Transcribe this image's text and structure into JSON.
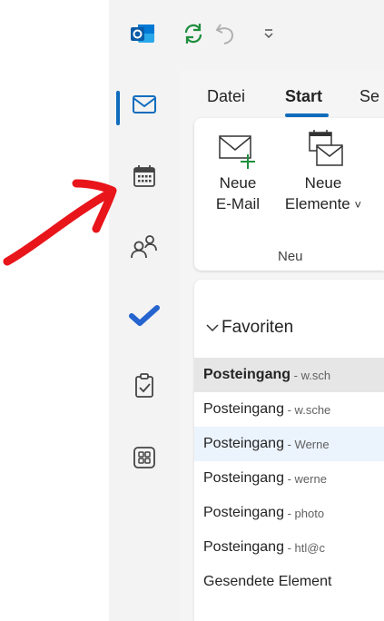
{
  "titlebar": {
    "icons": [
      "outlook-logo-icon",
      "sync-icon",
      "undo-icon",
      "customize-quick-access-icon"
    ]
  },
  "rail": {
    "items": [
      {
        "name": "mail",
        "icon": "mail-icon",
        "active": true
      },
      {
        "name": "calendar",
        "icon": "calendar-icon",
        "active": false
      },
      {
        "name": "people",
        "icon": "people-icon",
        "active": false
      },
      {
        "name": "todo",
        "icon": "todo-check-icon",
        "active": false
      },
      {
        "name": "tasks",
        "icon": "clipboard-icon",
        "active": false
      },
      {
        "name": "apps",
        "icon": "apps-icon",
        "active": false
      }
    ]
  },
  "tabs": [
    {
      "label": "Datei",
      "active": false
    },
    {
      "label": "Start",
      "active": true
    },
    {
      "label": "Se",
      "active": false
    }
  ],
  "ribbon": {
    "new_mail": {
      "line1": "Neue",
      "line2": "E-Mail"
    },
    "new_items": {
      "line1": "Neue",
      "line2": "Elemente",
      "chevron": "˅"
    },
    "group_label": "Neu"
  },
  "folders": {
    "favorites_label": "Favoriten",
    "items": [
      {
        "name": "Posteingang",
        "account": "w.sch",
        "state": "selected"
      },
      {
        "name": "Posteingang",
        "account": "w.sche",
        "state": "normal"
      },
      {
        "name": "Posteingang",
        "account": "Werne",
        "state": "hover"
      },
      {
        "name": "Posteingang",
        "account": "werne",
        "state": "normal"
      },
      {
        "name": "Posteingang",
        "account": "photo",
        "state": "normal"
      },
      {
        "name": "Posteingang",
        "account": "htl@c",
        "state": "normal"
      },
      {
        "name": "Gesendete Element",
        "account": "",
        "state": "normal"
      }
    ]
  },
  "colors": {
    "accent": "#0f6cbd",
    "annotation": "#e8151b",
    "todo": "#2564cf"
  }
}
